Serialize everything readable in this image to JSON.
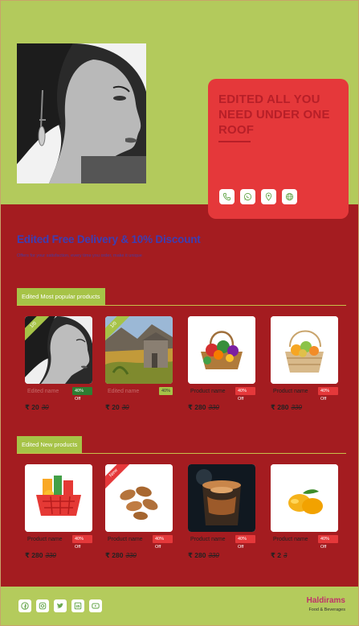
{
  "hero": {
    "title": "EDITED ALL YOU NEED UNDER ONE ROOF",
    "contacts": [
      {
        "icon": "phone-icon"
      },
      {
        "icon": "whatsapp-icon"
      },
      {
        "icon": "location-icon"
      },
      {
        "icon": "globe-icon"
      }
    ]
  },
  "promo": {
    "title": "Edited Free Delivery & 10% Discount",
    "subtitle": "Offers for your satisfaction, every time you order, make it unique"
  },
  "sections": [
    {
      "label": "Edited Most popular products",
      "products": [
        {
          "name": "Edited name",
          "badge": "40% Off",
          "price": "₹ 20",
          "old_price": "30",
          "ribbon": "1/0",
          "image": "woman-portrait"
        },
        {
          "name": "Edited name",
          "badge": "40%",
          "price": "₹ 20",
          "old_price": "30",
          "ribbon": "1/0",
          "image": "mountain-house"
        },
        {
          "name": "Product name",
          "badge": "40% Off",
          "price": "₹ 280",
          "old_price": "330",
          "ribbon": "",
          "image": "vegetable-basket"
        },
        {
          "name": "Product name",
          "badge": "40% Off",
          "price": "₹ 280",
          "old_price": "330",
          "ribbon": "",
          "image": "fruit-basket"
        }
      ]
    },
    {
      "label": "Edited New products",
      "products": [
        {
          "name": "Product name",
          "badge": "40% Off",
          "price": "₹ 280",
          "old_price": "330",
          "ribbon": "",
          "image": "grocery-basket"
        },
        {
          "name": "Product name",
          "badge": "40% Off",
          "price": "₹ 280",
          "old_price": "330",
          "ribbon": "New",
          "image": "almonds"
        },
        {
          "name": "Product name",
          "badge": "40% Off",
          "price": "₹ 280",
          "old_price": "330",
          "ribbon": "",
          "image": "coffee-cup"
        },
        {
          "name": "Product name",
          "badge": "40% Off",
          "price": "₹ 2",
          "old_price": "3",
          "ribbon": "",
          "image": "mangoes"
        }
      ]
    }
  ],
  "footer": {
    "brand": "Haldirams",
    "tagline": "Food & Beverages",
    "social": [
      "facebook-icon",
      "instagram-icon",
      "twitter-icon",
      "linkedin-icon",
      "youtube-icon"
    ]
  },
  "colors": {
    "top_green": "#b3ca5c",
    "main_red": "#a41c20",
    "card_red": "#e5383a",
    "accent_green": "#a6c347",
    "promo_blue": "#3b3eb4",
    "brand_pink": "#c0306a"
  }
}
